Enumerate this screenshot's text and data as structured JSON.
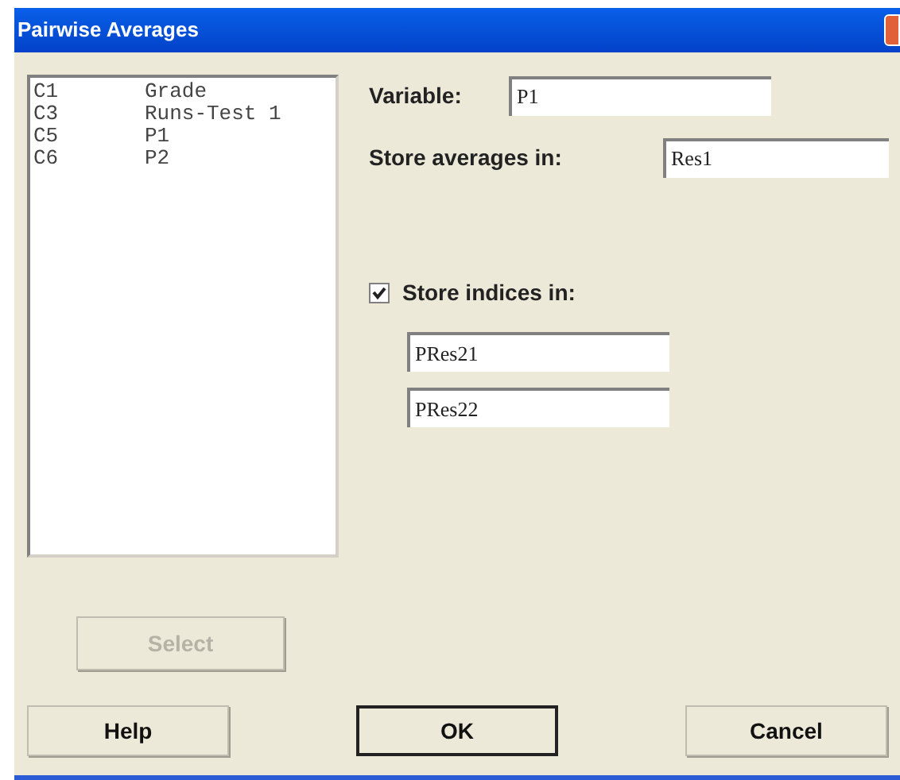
{
  "window": {
    "title": "Pairwise Averages"
  },
  "variables": [
    {
      "column": "C1",
      "name": "Grade"
    },
    {
      "column": "C3",
      "name": "Runs-Test 1"
    },
    {
      "column": "C5",
      "name": "P1"
    },
    {
      "column": "C6",
      "name": "P2"
    }
  ],
  "variable": {
    "label": "Variable:",
    "value": "P1"
  },
  "store_averages": {
    "label": "Store averages in:",
    "value": "Res1"
  },
  "store_indices": {
    "label": "Store indices in:",
    "checked": true,
    "values": [
      "PRes21",
      "PRes22"
    ]
  },
  "select_button": {
    "label": "Select",
    "disabled": true
  },
  "buttons": [
    {
      "label": "Help",
      "default": false
    },
    {
      "label": "OK",
      "default": true
    },
    {
      "label": "Cancel",
      "default": false
    }
  ]
}
